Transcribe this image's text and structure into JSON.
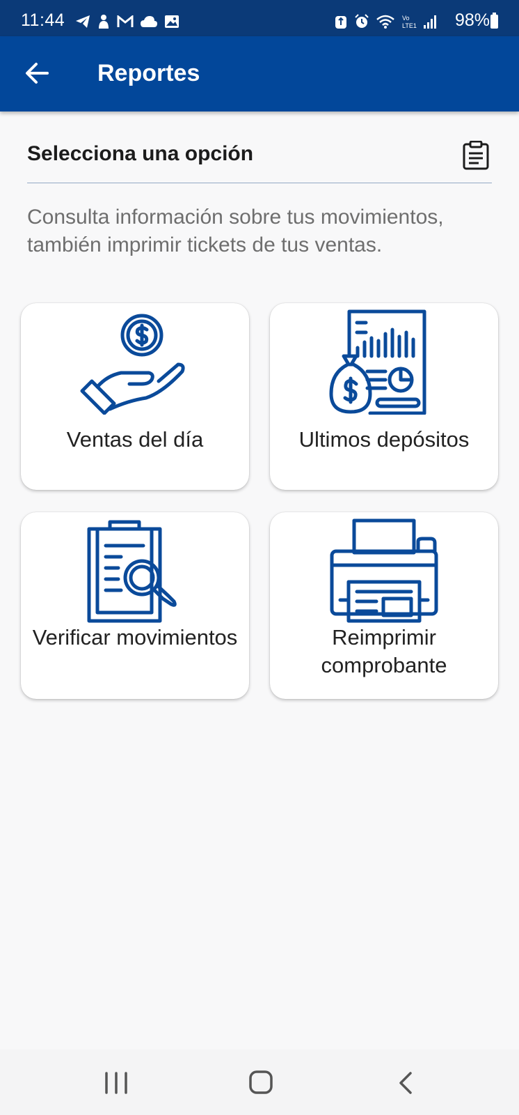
{
  "status_bar": {
    "time": "11:44",
    "battery_percent": "98%",
    "left_icons": [
      "telegram-icon",
      "notification-icon",
      "gmail-icon",
      "cloud-icon",
      "gallery-icon"
    ],
    "right_icons": [
      "recycle-icon",
      "alarm-icon",
      "wifi-icon",
      "volte-icon",
      "signal-icon",
      "battery-icon"
    ]
  },
  "app_bar": {
    "title": "Reportes"
  },
  "section": {
    "title": "Selecciona una opción",
    "description": "Consulta información sobre tus movimientos, también imprimir tickets de tus ventas."
  },
  "options": [
    {
      "label": "Ventas del día",
      "icon": "hand-coin-icon"
    },
    {
      "label": "Ultimos depósitos",
      "icon": "deposit-report-icon"
    },
    {
      "label": "Verificar movimientos",
      "icon": "clipboard-search-icon"
    },
    {
      "label": "Reimprimir comprobante",
      "icon": "printer-icon"
    }
  ],
  "nav_bar": {
    "buttons": [
      "recents-icon",
      "home-icon",
      "back-icon"
    ]
  },
  "colors": {
    "status_bar": "#0b3a78",
    "app_bar": "#02479a",
    "icon_blue": "#0a4a9a",
    "background": "#f8f8f9"
  }
}
